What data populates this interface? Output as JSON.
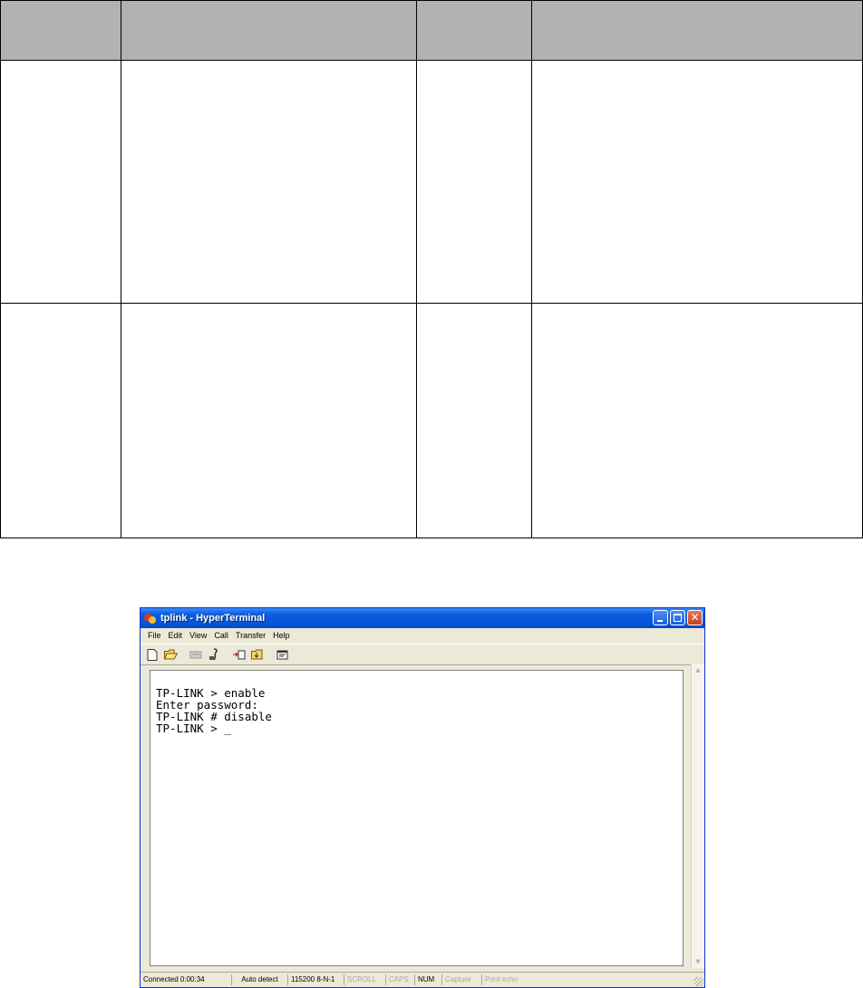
{
  "window": {
    "title": "tplink - HyperTerminal",
    "buttons": {
      "minimize": "minimize",
      "maximize": "maximize",
      "close": "✕"
    }
  },
  "menu": [
    "File",
    "Edit",
    "View",
    "Call",
    "Transfer",
    "Help"
  ],
  "toolbar": [
    "new-icon",
    "open-icon",
    "disconnect-icon",
    "dial-icon",
    "send-icon",
    "receive-icon",
    "properties-icon"
  ],
  "terminal": {
    "lines": [
      "TP-LINK > enable",
      "Enter password:",
      "TP-LINK # disable",
      "TP-LINK > _"
    ]
  },
  "status": {
    "connected": "Connected 0:00:34",
    "detect": "Auto detect",
    "port": "115200 8-N-1",
    "scroll": "SCROLL",
    "caps": "CAPS",
    "num": "NUM",
    "capture": "Capture",
    "print_echo": "Print echo"
  }
}
